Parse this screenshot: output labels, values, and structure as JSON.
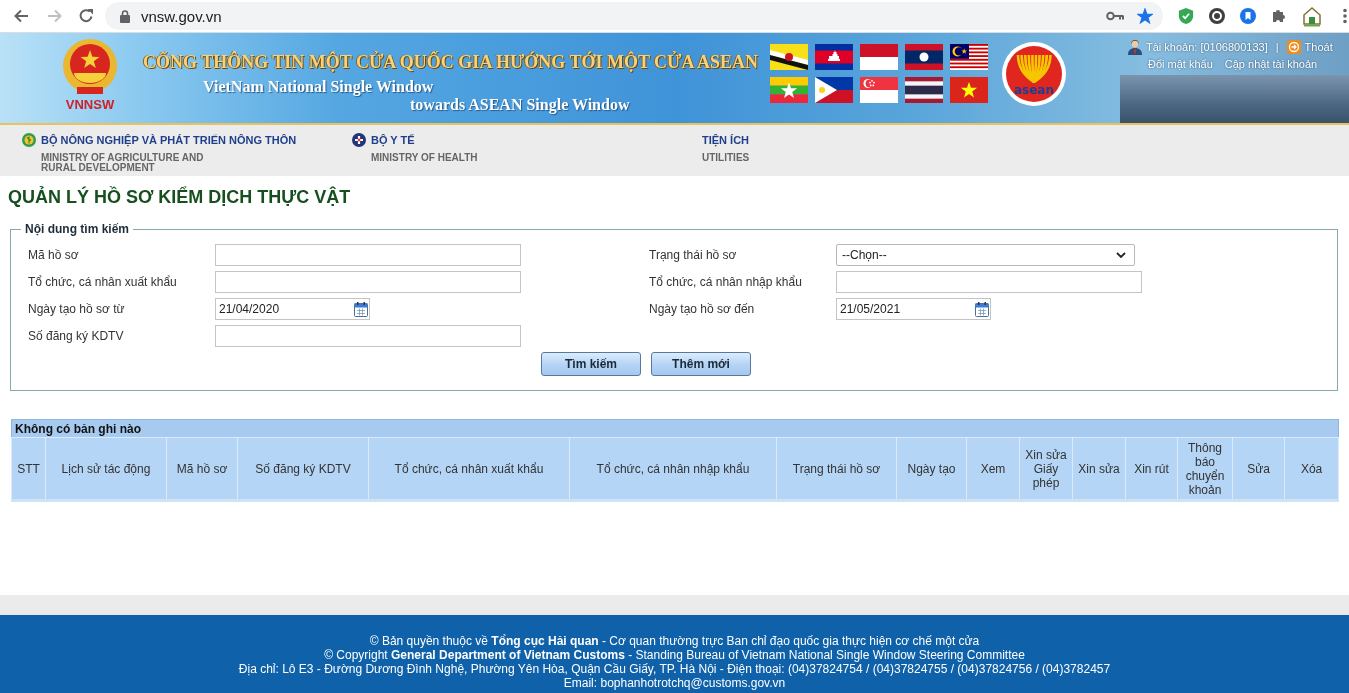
{
  "browser": {
    "url": "vnsw.gov.vn",
    "forward_disabled": true,
    "bookmarked": true
  },
  "banner": {
    "emblem_label": "VNNSW",
    "title": "CỔNG THÔNG TIN MỘT CỬA QUỐC GIA HƯỚNG TỚI MỘT CỬA ASEAN",
    "subtitle_lines": [
      "VietNam National Single Window",
      "towards ASEAN Single Window"
    ],
    "logo_text": "asean",
    "account": {
      "label": "Tài khoản: [0106800133]",
      "separator": "|",
      "logout": "Thoát",
      "links": [
        "Đổi mật khẩu",
        "Cập nhật tài khoản"
      ]
    }
  },
  "menu": [
    {
      "kind": "agriculture",
      "title": "BỘ NÔNG NGHIỆP VÀ PHÁT TRIỂN NÔNG THÔN",
      "subtitle": "MINISTRY OF AGRICULTURE AND RURAL DEVELOPMENT"
    },
    {
      "kind": "health",
      "title": "BỘ Y TẾ",
      "subtitle": "MINISTRY OF HEALTH"
    },
    {
      "kind": "plain",
      "title": "TIỆN ÍCH",
      "subtitle": "UTILITIES"
    }
  ],
  "page_title": "QUẢN LÝ HỒ SƠ KIỂM DỊCH THỰC VẬT",
  "search": {
    "legend": "Nội dung tìm kiếm",
    "fields": [
      {
        "kind": "text",
        "label": "Mã hồ sơ"
      },
      {
        "kind": "select",
        "label": "Trạng thái hồ sơ",
        "value": "--Chọn--"
      },
      {
        "kind": "text",
        "label": "Tổ chức, cá nhân xuất khẩu"
      },
      {
        "kind": "text",
        "label": "Tổ chức, cá nhân nhập khẩu"
      },
      {
        "kind": "date",
        "label": "Ngày tạo hồ sơ từ",
        "value": "21/04/2020"
      },
      {
        "kind": "date",
        "label": "Ngày tạo hồ sơ đến",
        "value": "21/05/2021"
      },
      {
        "kind": "text",
        "label": "Số đăng ký KDTV"
      }
    ],
    "buttons": [
      "Tìm kiếm",
      "Thêm mới"
    ]
  },
  "table": {
    "caption": "Không có bản ghi nào",
    "columns": [
      "STT",
      "Lịch sử tác động",
      "Mã hồ sơ",
      "Số đăng ký KDTV",
      "Tổ chức, cá nhân xuất khẩu",
      "Tổ chức, cá nhân nhập khẩu",
      "Trạng thái hồ sơ",
      "Ngày tạo",
      "Xem",
      "Xin sửa Giấy phép",
      "Xin sửa",
      "Xin rút",
      "Thông báo chuyển khoản",
      "Sửa",
      "Xóa"
    ]
  },
  "footer": {
    "lines": [
      "© Bản quyền thuộc về **Tổng cục Hải quan** - Cơ quan thường trực Ban chỉ đạo quốc gia thực hiện cơ chế một cửa",
      "© Copyright **General Department of Vietnam Customs** - Standing Bureau of Vietnam National Single Window Steering Committee",
      "Địa chỉ: Lô E3 - Đường Dương Đình Nghệ, Phường Yên Hòa, Quận Cầu Giấy, TP. Hà Nội - Điện thoại: (04)37824754 / (04)37824755 / (04)37824756 / (04)3782457",
      "Email: bophanhotrotchq@customs.gov.vn"
    ]
  }
}
